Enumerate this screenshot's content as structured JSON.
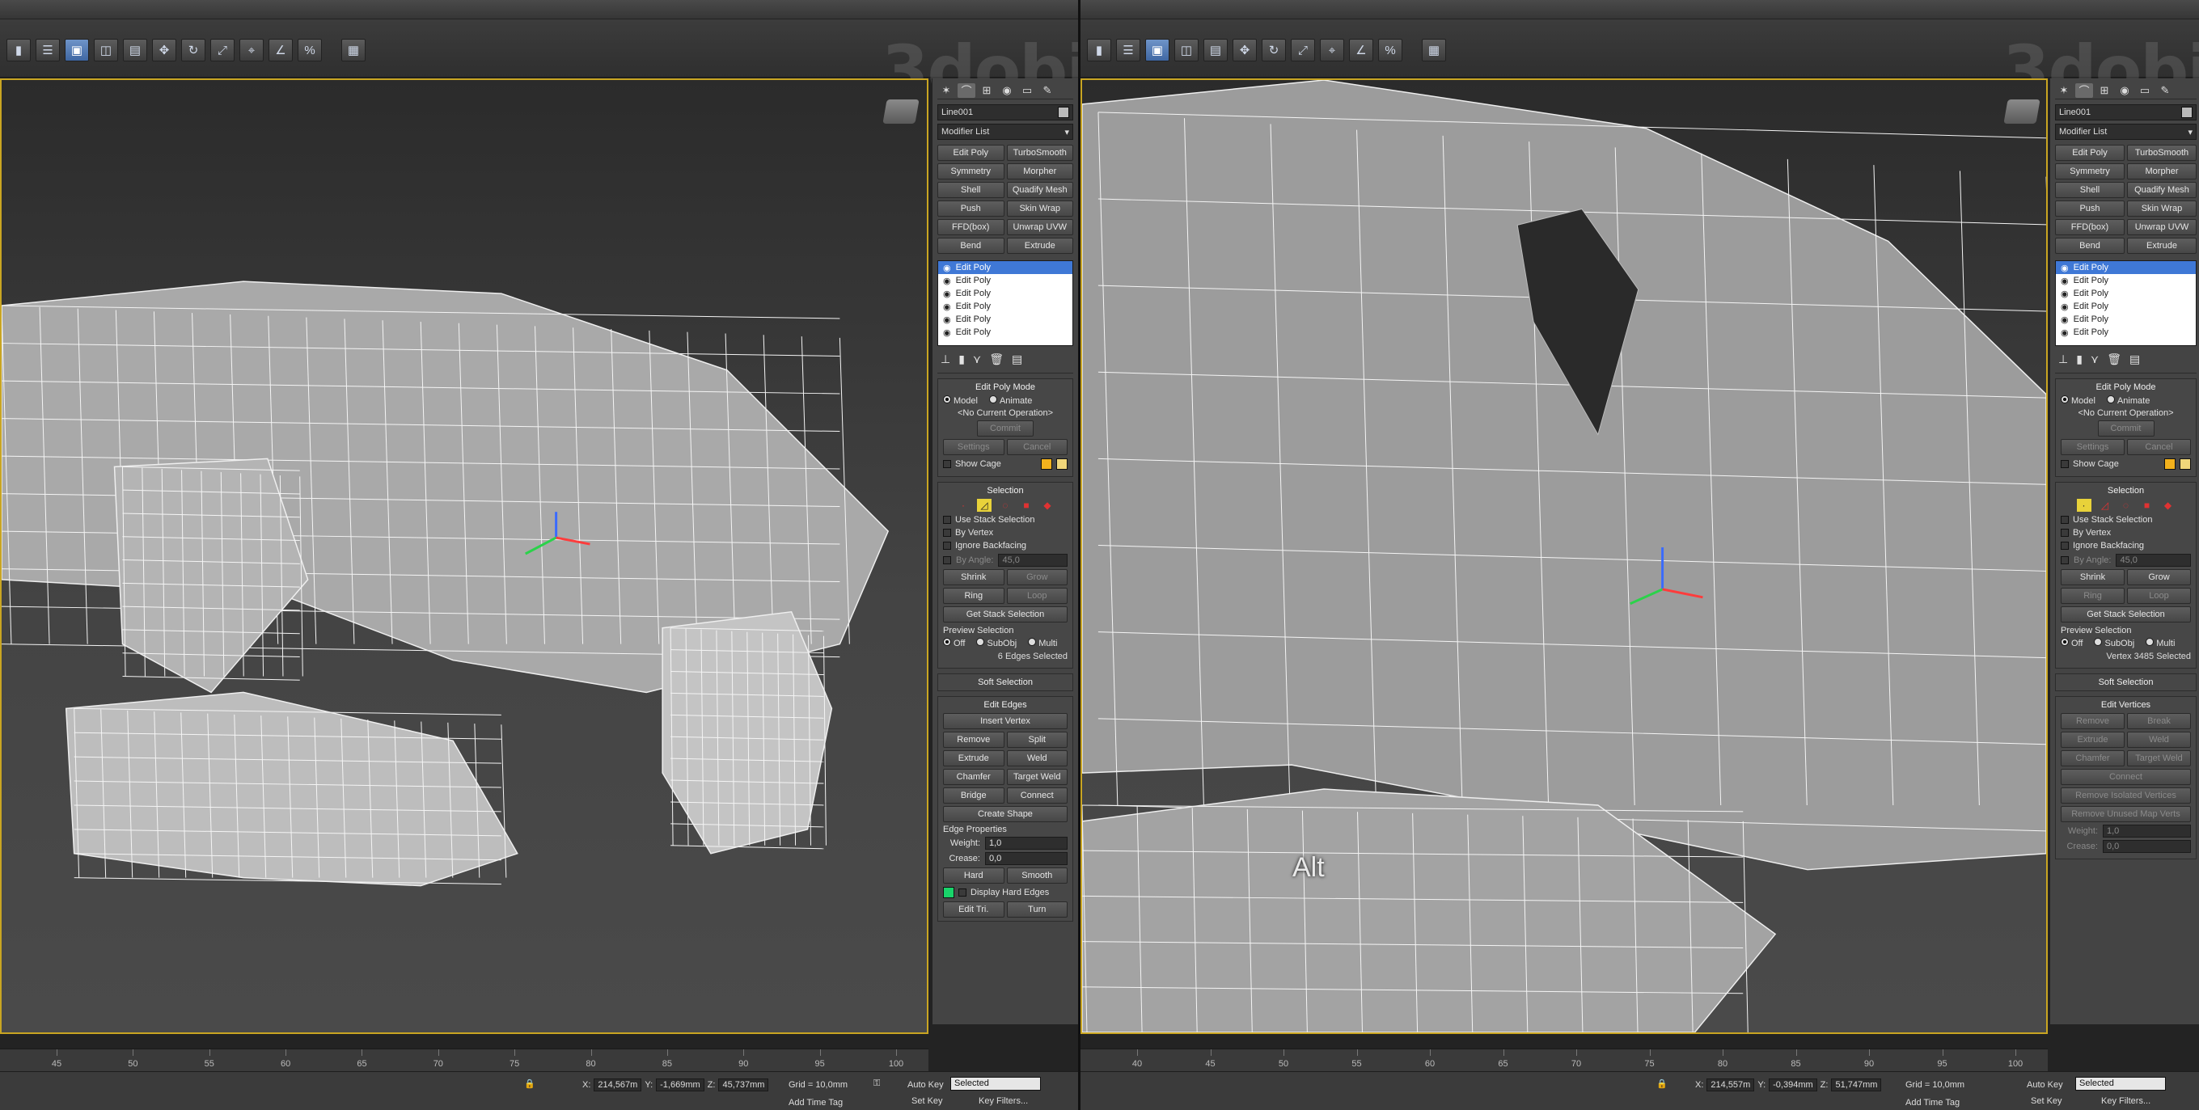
{
  "watermark": "3dobj",
  "tabs": [
    "create-icon",
    "modify-icon",
    "hierarchy-icon",
    "motion-icon",
    "display-icon",
    "utilities-icon"
  ],
  "object_name": "Line001",
  "modifier_list": "Modifier List",
  "modifier_buttons": [
    [
      "Edit Poly",
      "TurboSmooth"
    ],
    [
      "Symmetry",
      "Morpher"
    ],
    [
      "Shell",
      "Quadify Mesh"
    ],
    [
      "Push",
      "Skin Wrap"
    ],
    [
      "FFD(box)",
      "Unwrap UVW"
    ],
    [
      "Bend",
      "Extrude"
    ]
  ],
  "stack_items": [
    "Edit Poly",
    "Edit Poly",
    "Edit Poly",
    "Edit Poly",
    "Edit Poly",
    "Edit Poly"
  ],
  "edit_poly_mode": {
    "title": "Edit Poly Mode",
    "model": "Model",
    "animate": "Animate",
    "operation": "<No Current Operation>",
    "commit": "Commit",
    "settings": "Settings",
    "cancel": "Cancel",
    "show_cage": "Show Cage"
  },
  "selection": {
    "title": "Selection",
    "use_stack": "Use Stack Selection",
    "by_vertex": "By Vertex",
    "ignore_backfacing": "Ignore Backfacing",
    "by_angle": "By Angle:",
    "angle_value": "45,0",
    "shrink": "Shrink",
    "grow": "Grow",
    "ring": "Ring",
    "loop": "Loop",
    "get_stack": "Get Stack Selection",
    "preview_title": "Preview Selection",
    "preview_opts": [
      "Off",
      "SubObj",
      "Multi"
    ]
  },
  "left": {
    "status": "6 Edges Selected",
    "soft_selection": "Soft Selection",
    "edit_edges": {
      "title": "Edit Edges",
      "insert_vertex": "Insert Vertex",
      "remove": "Remove",
      "split": "Split",
      "extrude": "Extrude",
      "weld": "Weld",
      "chamfer": "Chamfer",
      "target_weld": "Target Weld",
      "bridge": "Bridge",
      "connect": "Connect",
      "create_shape": "Create Shape",
      "edge_props": "Edge Properties",
      "weight": "Weight:",
      "weight_val": "1,0",
      "crease": "Crease:",
      "crease_val": "0,0",
      "hard": "Hard",
      "smooth": "Smooth",
      "display_hard": "Display Hard Edges",
      "edit_tri": "Edit Tri.",
      "turn": "Turn"
    },
    "ticks": [
      "45",
      "50",
      "55",
      "60",
      "65",
      "70",
      "75",
      "80",
      "85",
      "90",
      "95",
      "100"
    ],
    "coords": {
      "x": "214,567m",
      "y": "-1,669mm",
      "z": "45,737mm"
    },
    "grid": "Grid = 10,0mm"
  },
  "right": {
    "status": "Vertex 3485 Selected",
    "soft_selection": "Soft Selection",
    "edit_vertices": {
      "title": "Edit Vertices",
      "remove": "Remove",
      "break": "Break",
      "extrude": "Extrude",
      "weld": "Weld",
      "chamfer": "Chamfer",
      "target_weld": "Target Weld",
      "connect": "Connect",
      "remove_isolated": "Remove Isolated Vertices",
      "remove_unused": "Remove Unused Map Verts",
      "weight": "Weight:",
      "weight_val": "1,0",
      "crease": "Crease:",
      "crease_val": "0,0"
    },
    "ticks": [
      "40",
      "45",
      "50",
      "55",
      "60",
      "65",
      "70",
      "75",
      "80",
      "85",
      "90",
      "95",
      "100"
    ],
    "coords": {
      "x": "214,557m",
      "y": "-0,394mm",
      "z": "51,747mm"
    },
    "grid": "Grid = 10,0mm",
    "overlay": "Alt"
  },
  "status_bar": {
    "auto_key": "Auto Key",
    "set_key": "Set Key",
    "selected": "Selected",
    "key_filters": "Key Filters...",
    "add_time_tag": "Add Time Tag"
  }
}
